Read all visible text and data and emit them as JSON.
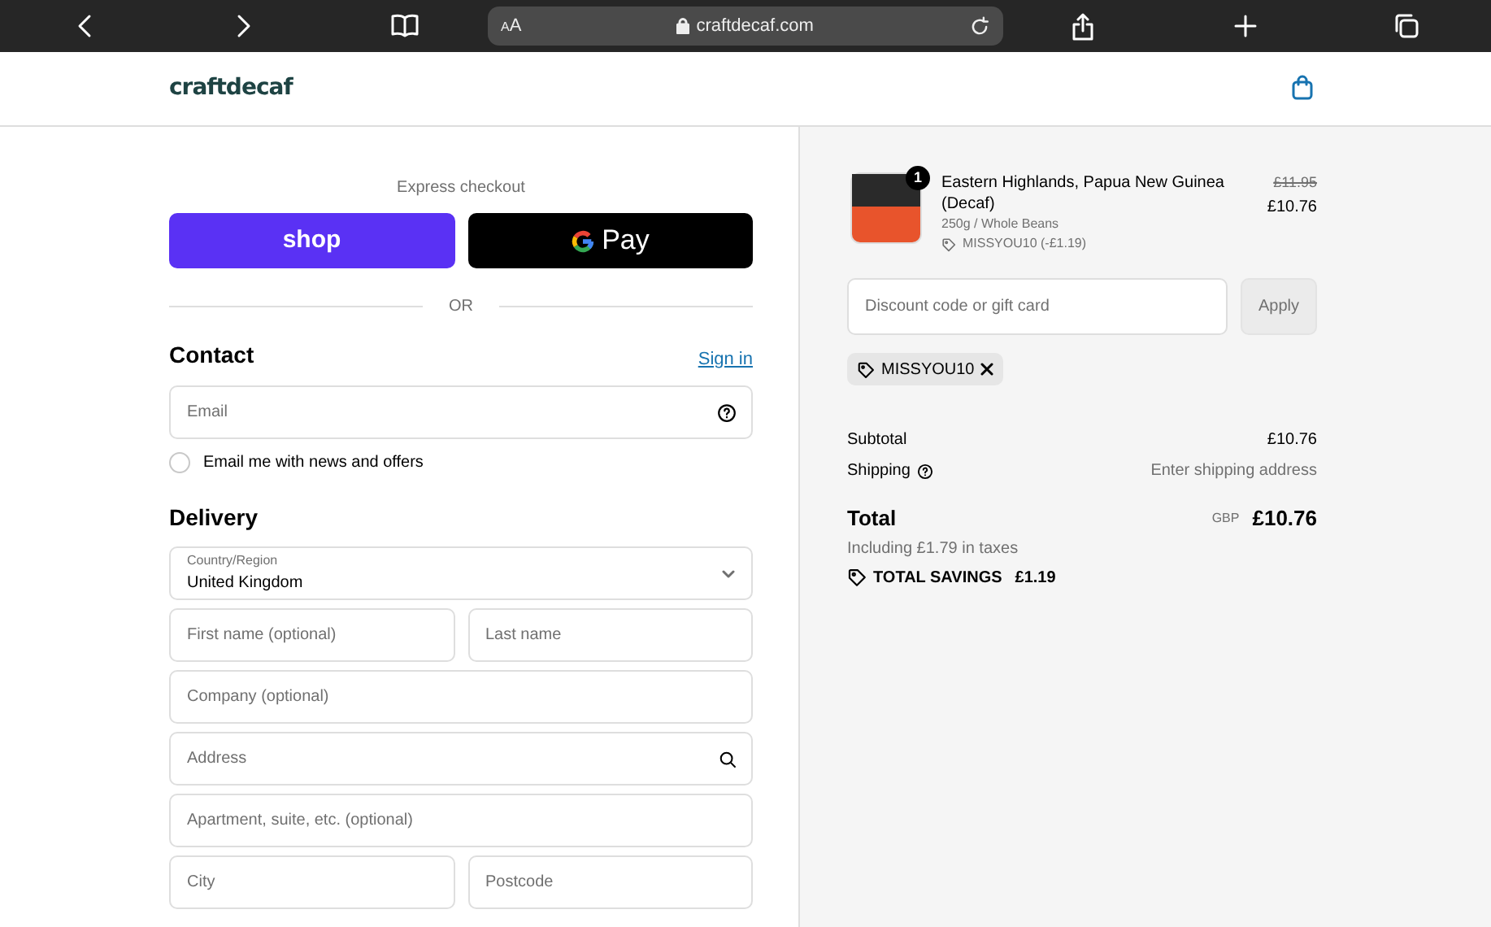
{
  "browser": {
    "text_size_button": "AA",
    "url": "craftdecaf.com"
  },
  "header": {
    "logo": "craftdecaf"
  },
  "express_checkout": {
    "title": "Express checkout",
    "buttons": [
      {
        "kind": "shop",
        "label": "shop"
      },
      {
        "kind": "gpay",
        "label": "Pay"
      }
    ]
  },
  "divider": "OR",
  "contact": {
    "title": "Contact",
    "sign_in": "Sign in",
    "email": {
      "placeholder": "Email"
    },
    "newsletter": {
      "label": "Email me with news and offers",
      "checked": false
    }
  },
  "delivery": {
    "title": "Delivery",
    "country": {
      "label": "Country/Region",
      "value": "United Kingdom"
    },
    "rows": [
      [
        {
          "placeholder": "First name (optional)",
          "kind": "text"
        },
        {
          "placeholder": "Last name",
          "kind": "text"
        }
      ],
      [
        {
          "placeholder": "Company (optional)",
          "kind": "text"
        }
      ],
      [
        {
          "placeholder": "Address",
          "kind": "search"
        }
      ],
      [
        {
          "placeholder": "Apartment, suite, etc. (optional)",
          "kind": "text"
        }
      ],
      [
        {
          "placeholder": "City",
          "kind": "text"
        },
        {
          "placeholder": "Postcode",
          "kind": "text"
        }
      ]
    ]
  },
  "summary": {
    "items": [
      {
        "quantity": "1",
        "name": "Eastern Highlands, Papua New Guinea (Decaf)",
        "variant": "250g / Whole Beans",
        "discount": "MISSYOU10 (-£1.19)",
        "original_price": "£11.95",
        "price": "£10.76"
      }
    ],
    "discount_field": {
      "placeholder": "Discount code or gift card"
    },
    "apply_button": {
      "label": "Apply",
      "disabled": true
    },
    "applied_codes": [
      {
        "code": "MISSYOU10"
      }
    ],
    "subtotal": {
      "label": "Subtotal",
      "value": "£10.76"
    },
    "shipping": {
      "label": "Shipping",
      "value": "Enter shipping address"
    },
    "total": {
      "label": "Total",
      "currency": "GBP",
      "value": "£10.76",
      "taxes": "Including £1.79 in taxes"
    },
    "savings": {
      "label": "TOTAL SAVINGS",
      "value": "£1.19"
    }
  }
}
